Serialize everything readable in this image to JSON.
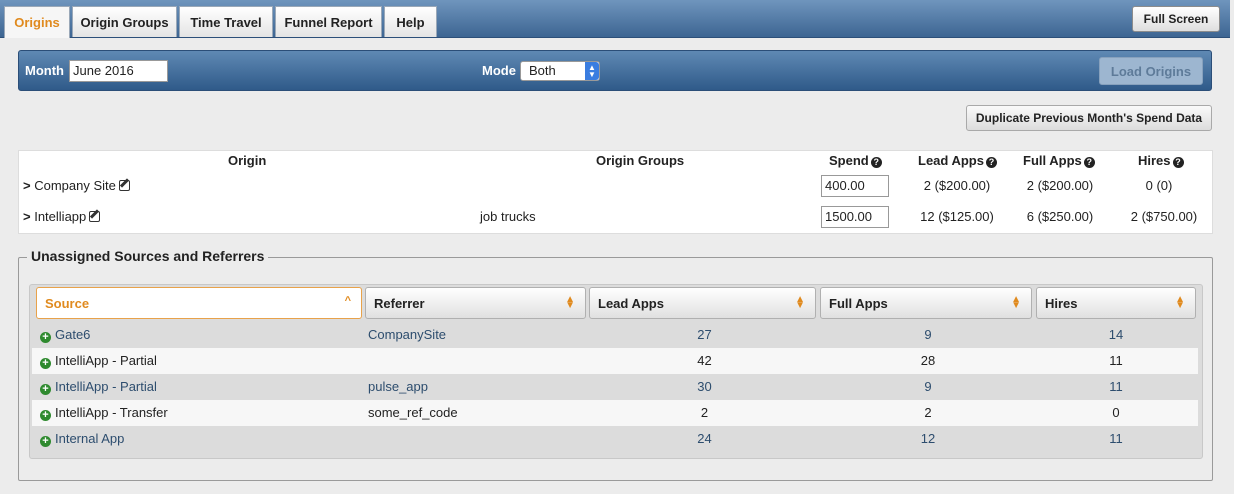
{
  "tabs": [
    "Origins",
    "Origin Groups",
    "Time Travel",
    "Funnel Report",
    "Help"
  ],
  "full_screen_label": "Full Screen",
  "filter": {
    "month_label": "Month",
    "month_value": "June 2016",
    "mode_label": "Mode",
    "mode_value": "Both",
    "load_label": "Load Origins"
  },
  "duplicate_label": "Duplicate Previous Month's Spend Data",
  "origins": {
    "headers": {
      "origin": "Origin",
      "groups": "Origin Groups",
      "spend": "Spend",
      "lead": "Lead Apps",
      "full": "Full Apps",
      "hires": "Hires"
    },
    "rows": [
      {
        "name": "Company Site",
        "groups": "",
        "spend": "400.00",
        "lead": "2 ($200.00)",
        "full": "2 ($200.00)",
        "hires": "0 (0)"
      },
      {
        "name": "Intelliapp",
        "groups": "job trucks",
        "spend": "1500.00",
        "lead": "12 ($125.00)",
        "full": "6 ($250.00)",
        "hires": "2 ($750.00)"
      }
    ]
  },
  "unassigned": {
    "legend": "Unassigned Sources and Referrers",
    "headers": [
      "Source",
      "Referrer",
      "Lead Apps",
      "Full Apps",
      "Hires"
    ],
    "rows": [
      {
        "source": "Gate6",
        "referrer": "CompanySite",
        "lead": "27",
        "full": "9",
        "hires": "14"
      },
      {
        "source": "IntelliApp - Partial",
        "referrer": "",
        "lead": "42",
        "full": "28",
        "hires": "11"
      },
      {
        "source": "IntelliApp - Partial",
        "referrer": "pulse_app",
        "lead": "30",
        "full": "9",
        "hires": "11"
      },
      {
        "source": "IntelliApp - Transfer",
        "referrer": "some_ref_code",
        "lead": "2",
        "full": "2",
        "hires": "0"
      },
      {
        "source": "Internal App",
        "referrer": "",
        "lead": "24",
        "full": "12",
        "hires": "11"
      }
    ]
  }
}
